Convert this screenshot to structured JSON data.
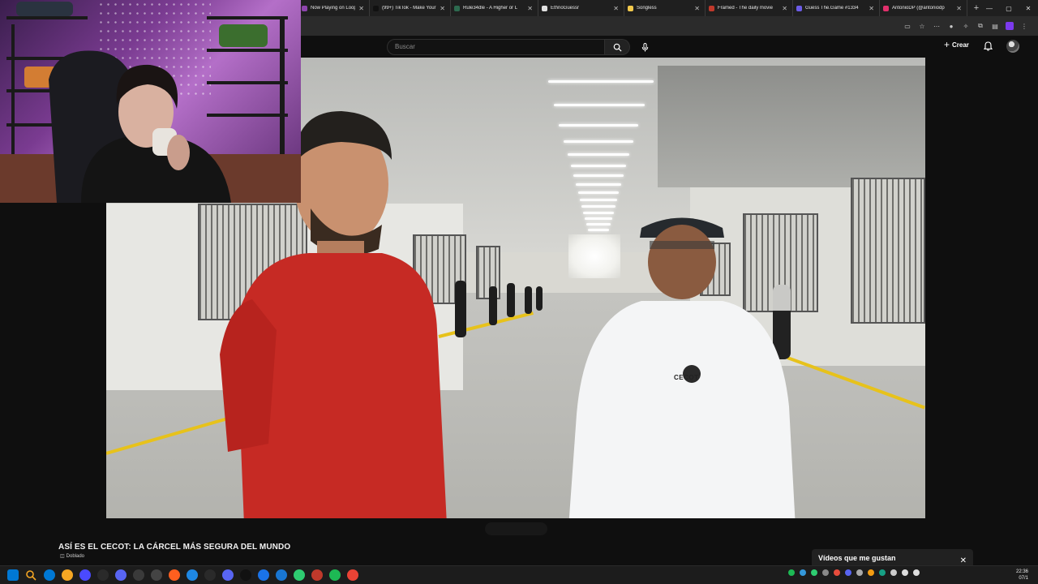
{
  "browser": {
    "tabs": [
      {
        "title": "Now Playing on Loop Sven: Silk Spectre o",
        "color": "#8e44ad"
      },
      {
        "title": "(99+) TikTok - Make Your D",
        "color": "#111111"
      },
      {
        "title": "Rule34dle - A Higher or L",
        "color": "#2d6a4f"
      },
      {
        "title": "EthnoGuessr",
        "color": "#e0e0e0"
      },
      {
        "title": "Songless",
        "color": "#f2c94c"
      },
      {
        "title": "Framed - The daily movie",
        "color": "#c0392b"
      },
      {
        "title": "Guess The.Game #1334",
        "color": "#6c5ce7"
      },
      {
        "title": "AntonioDP (@antoniodp",
        "color": "#e1306c"
      }
    ],
    "new_tab": "+",
    "window_controls": [
      "—",
      "▢",
      "✕"
    ]
  },
  "youtube": {
    "search_placeholder": "Buscar",
    "create_label": "Crear",
    "video_title": "ASÍ ES EL CECOT: LA CÁRCEL MÁS SEGURA DEL MUNDO",
    "dub_label": "Doblado",
    "liked_panel_label": "Vídeos que me gustan",
    "liked_panel_close": "✕",
    "shirt_logo": "CECOT"
  },
  "taskbar": {
    "time": "22:36",
    "date": "07/1",
    "apps": [
      "#0078d4",
      "#f5a623",
      "#4a4aff",
      "#2a2a2a",
      "#5865f2",
      "#3a3a3a",
      "#444444",
      "#ff5f1f",
      "#1e88e5",
      "#2a2a2a",
      "#5865f2",
      "#111111",
      "#1a73e8",
      "#1976d2",
      "#2ecc71",
      "#c0392b",
      "#1db954",
      "#ea4335"
    ]
  },
  "colors": {
    "page_bg": "#0f0f0f",
    "tabstrip_bg": "#1f1f1f",
    "accent_yellow": "#e7c21b",
    "shirt_red": "#c62a24"
  }
}
